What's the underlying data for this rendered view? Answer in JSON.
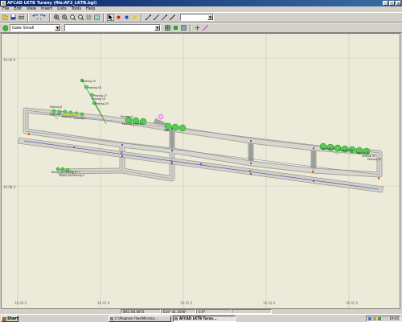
{
  "window": {
    "title": "AFCAD   LKTB   Turany   (file:AF2_LKTB.bgl)",
    "min": "_",
    "max": "□",
    "close": "×"
  },
  "menu": [
    "File",
    "Edit",
    "View",
    "Insert",
    "Lists",
    "Tools",
    "Help"
  ],
  "toolbar2": {
    "object_type": "Gate Small",
    "name_value": ""
  },
  "map": {
    "lat_labels": [
      "49.09.0",
      "49.08.0"
    ],
    "lon_labels": [
      "16.40.5",
      "16.41.0",
      "16.41.5",
      "16.42.0",
      "16.42.5"
    ],
    "parking_labels": [
      "Parking 15",
      "Parking 16",
      "Parking 17",
      "Parking 19",
      "Parking 20",
      "Parking 8",
      "Parking 1",
      "Parking 2",
      "Parking 3",
      "Parking 4",
      "Parking 5",
      "Ramp GA Parking 2",
      "Ramp GA Parking 3",
      "Gate 1",
      "Gate 3",
      "Parking 25",
      "Parking 28",
      "Parking 31",
      "Parking 32",
      "Parking 33"
    ]
  },
  "status": {
    "heading": "BRG 08.0072",
    "position": "E16° 41.3590'",
    "field3": "0.0°",
    "field4": ""
  },
  "taskbar": {
    "start": "Start",
    "tasks": [
      "C:\\Program Files\\Microso...",
      "AFCAD   LKTB   Turan..."
    ],
    "clock": "19:45"
  }
}
